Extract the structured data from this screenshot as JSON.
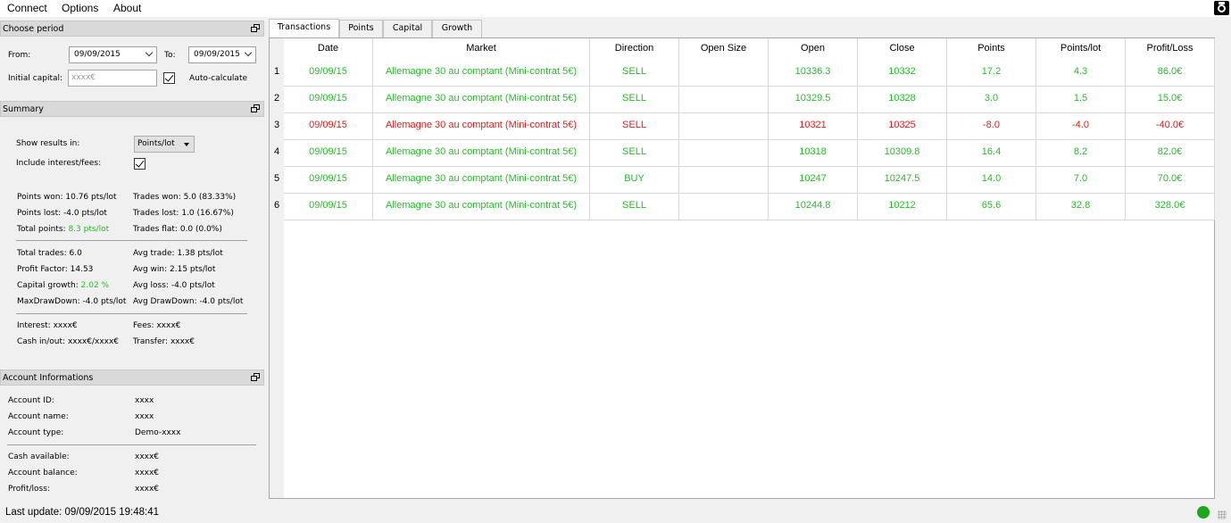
{
  "menu": {
    "items": [
      "Connect",
      "Options",
      "About"
    ]
  },
  "choose_period": {
    "title": "Choose period",
    "from_label": "From:",
    "from_value": "09/09/2015",
    "to_label": "To:",
    "to_value": "09/09/2015",
    "initial_capital_label": "Initial capital:",
    "initial_capital_placeholder": "xxxx€",
    "auto_calculate_label": "Auto-calculate",
    "auto_calculate_checked": true
  },
  "summary": {
    "title": "Summary",
    "show_results_label": "Show results in:",
    "show_results_value": "Points/lot",
    "include_interest_label": "Include interest/fees:",
    "include_interest_checked": true,
    "points_won_label": "Points won:",
    "points_won_value": "10.76 pts/lot",
    "points_lost_label": "Points lost:",
    "points_lost_value": "-4.0 pts/lot",
    "total_points_label": "Total points:",
    "total_points_value": "8.3 pts/lot",
    "trades_won_label": "Trades won:",
    "trades_won_value": "5.0 (83.33%)",
    "trades_lost_label": "Trades lost:",
    "trades_lost_value": "1.0 (16.67%)",
    "trades_flat_label": "Trades flat:",
    "trades_flat_value": "0.0 (0.0%)",
    "total_trades_label": "Total trades:",
    "total_trades_value": "6.0",
    "profit_factor_label": "Profit Factor:",
    "profit_factor_value": "14.53",
    "capital_growth_label": "Capital growth:",
    "capital_growth_value": "2.02 %",
    "max_drawdown_label": "MaxDrawDown:",
    "max_drawdown_value": "-4.0 pts/lot",
    "avg_trade_label": "Avg trade:",
    "avg_trade_value": "1.38 pts/lot",
    "avg_win_label": "Avg win:",
    "avg_win_value": "2.15 pts/lot",
    "avg_loss_label": "Avg loss:",
    "avg_loss_value": "-4.0 pts/lot",
    "avg_drawdown_label": "Avg DrawDown:",
    "avg_drawdown_value": "-4.0 pts/lot",
    "interest_label": "Interest:",
    "interest_value": "xxxx€",
    "fees_label": "Fees:",
    "fees_value": "xxxx€",
    "cash_inout_label": "Cash in/out:",
    "cash_inout_value": "xxxx€/xxxx€",
    "transfer_label": "Transfer:",
    "transfer_value": "xxxx€"
  },
  "account": {
    "title": "Account Informations",
    "id_label": "Account ID:",
    "id_value": "xxxx",
    "name_label": "Account name:",
    "name_value": "xxxx",
    "type_label": "Account type:",
    "type_value": "Demo-xxxx",
    "cash_label": "Cash available:",
    "cash_value": "xxxx€",
    "balance_label": "Account balance:",
    "balance_value": "xxxx€",
    "pl_label": "Profit/loss:",
    "pl_value": "xxxx€"
  },
  "tabs": [
    "Transactions",
    "Points",
    "Capital",
    "Growth"
  ],
  "table": {
    "columns": [
      "Date",
      "Market",
      "Direction",
      "Open Size",
      "Open",
      "Close",
      "Points",
      "Points/lot",
      "Profit/Loss"
    ],
    "rows": [
      {
        "num": "1",
        "status": "win",
        "date": "09/09/15",
        "market": "Allemagne 30 au comptant (Mini-contrat 5€)",
        "direction": "SELL",
        "open_size": "",
        "open": "10336.3",
        "close": "10332",
        "points": "17.2",
        "points_lot": "4.3",
        "pl": "86.0€"
      },
      {
        "num": "2",
        "status": "win",
        "date": "09/09/15",
        "market": "Allemagne 30 au comptant (Mini-contrat 5€)",
        "direction": "SELL",
        "open_size": "",
        "open": "10329.5",
        "close": "10328",
        "points": "3.0",
        "points_lot": "1.5",
        "pl": "15.0€"
      },
      {
        "num": "3",
        "status": "loss",
        "date": "09/09/15",
        "market": "Allemagne 30 au comptant (Mini-contrat 5€)",
        "direction": "SELL",
        "open_size": "",
        "open": "10321",
        "close": "10325",
        "points": "-8.0",
        "points_lot": "-4.0",
        "pl": "-40.0€"
      },
      {
        "num": "4",
        "status": "win",
        "date": "09/09/15",
        "market": "Allemagne 30 au comptant (Mini-contrat 5€)",
        "direction": "SELL",
        "open_size": "",
        "open": "10318",
        "close": "10309.8",
        "points": "16.4",
        "points_lot": "8.2",
        "pl": "82.0€"
      },
      {
        "num": "5",
        "status": "win",
        "date": "09/09/15",
        "market": "Allemagne 30 au comptant (Mini-contrat 5€)",
        "direction": "BUY",
        "open_size": "",
        "open": "10247",
        "close": "10247.5",
        "points": "14.0",
        "points_lot": "7.0",
        "pl": "70.0€"
      },
      {
        "num": "6",
        "status": "win",
        "date": "09/09/15",
        "market": "Allemagne 30 au comptant (Mini-contrat 5€)",
        "direction": "SELL",
        "open_size": "",
        "open": "10244.8",
        "close": "10212",
        "points": "65.6",
        "points_lot": "32.8",
        "pl": "328.0€"
      }
    ]
  },
  "status_bar": {
    "last_update": "Last update: 09/09/2015 19:48:41",
    "connection_color": "#1fa61f"
  },
  "colors": {
    "win": "#2db82d",
    "loss": "#d42121"
  }
}
